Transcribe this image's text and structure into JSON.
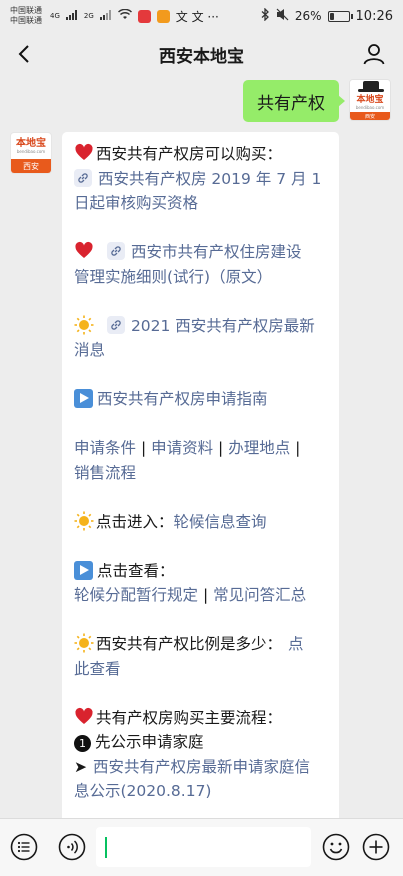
{
  "status": {
    "carrier1": "中国联通",
    "carrier2": "中国联通",
    "signal1": "4G",
    "signal2": "2G",
    "sys_chars": "文 文 ···",
    "battery_text": "26%",
    "battery_level": 0.26,
    "time": "10:26"
  },
  "header": {
    "title": "西安本地宝"
  },
  "avatars": {
    "bot_logo": "本地宝",
    "bot_domain": "bendibao.com",
    "bot_city": "西安",
    "user_logo": "本地宝",
    "user_domain": "bendibao.com",
    "user_tag": "西安"
  },
  "sent": {
    "text": "共有产权"
  },
  "reply": {
    "p1_title": "西安共有产权房可以购买：",
    "p1_link_a": "西安共有产权房 2019 年 7 月 1",
    "p1_link_b": "日起审核购买资格",
    "p2_link_a": "西安市共有产权住房建设",
    "p2_link_b": "管理实施细则(试行)（原文）",
    "p3_link_a": "2021 西安共有产权房最新",
    "p3_link_b": "消息",
    "p4_link": "西安共有产权房申请指南",
    "p5_l1": "申请条件",
    "p5_l2": "申请资料",
    "p5_l3": "办理地点",
    "p5_l4": "销售流程",
    "p5_sep": " | ",
    "p6_text": "点击进入：",
    "p6_link": "轮候信息查询",
    "p7_text": "点击查看：",
    "p7_l1": "轮候分配暂行规定",
    "p7_l2": "常见问答汇总",
    "p8_text": "西安共有产权比例是多少：",
    "p8_link_a": "点",
    "p8_link_b": "此查看",
    "p9_title": "共有产权房购买主要流程：",
    "p9_step_num": "1",
    "p9_step": "先公示申请家庭",
    "p9_arrow": "➤",
    "p9_link_a": "西安共有产权房最新申请家庭信",
    "p9_link_b": "息公示(2020.8.17)"
  },
  "input": {
    "value": ""
  }
}
